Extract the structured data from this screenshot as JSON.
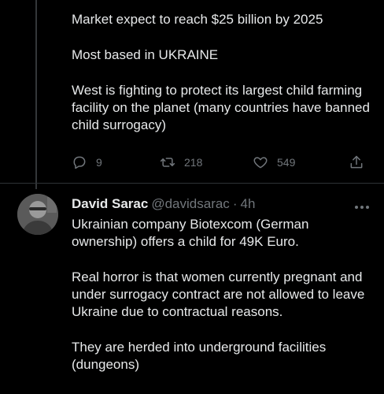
{
  "tweet1": {
    "paragraphs": [
      "Market expect to reach $25 billion by 2025",
      "Most based in UKRAINE",
      "West is fighting to protect its largest child farming facility on the planet (many countries have banned child surrogacy)"
    ],
    "actions": {
      "reply_icon": "reply-icon",
      "reply_count": "9",
      "retweet_icon": "retweet-icon",
      "retweet_count": "218",
      "like_icon": "heart-icon",
      "like_count": "549",
      "share_icon": "share-icon"
    }
  },
  "tweet2": {
    "author_name": "David Sarac",
    "handle": "@davidsarac",
    "separator": "·",
    "time": "4h",
    "paragraphs": [
      "Ukrainian company Biotexcom (German ownership) offers a child for 49K Euro.",
      "Real horror is that women currently pregnant and under surrogacy contract are not allowed to leave Ukraine due to contractual reasons.",
      "They are herded into underground facilities (dungeons)"
    ]
  },
  "colors": {
    "background": "#000000",
    "text": "#e7e9ea",
    "muted": "#71767b",
    "divider": "#2f3336"
  }
}
